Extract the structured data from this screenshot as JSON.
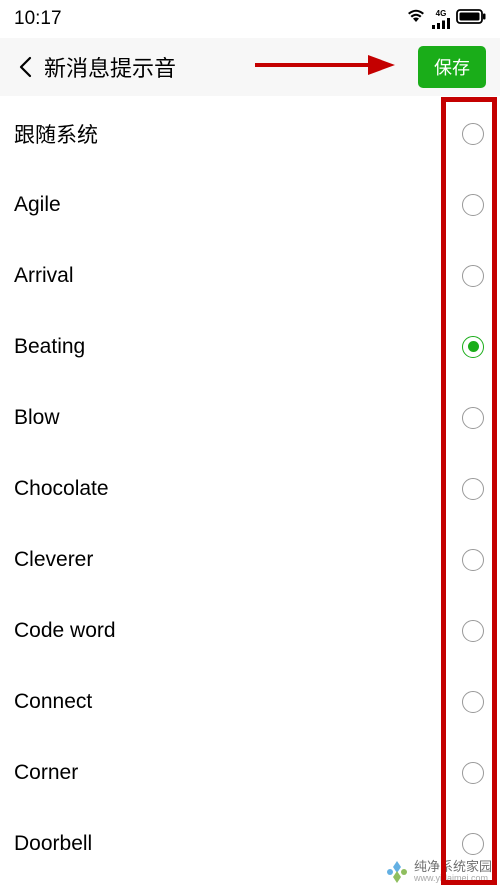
{
  "status": {
    "time": "10:17",
    "network_type": "4G"
  },
  "header": {
    "title": "新消息提示音",
    "save_label": "保存"
  },
  "colors": {
    "accent": "#1aad19",
    "annotation": "#c40000"
  },
  "list": {
    "items": [
      {
        "label": "跟随系统",
        "selected": false
      },
      {
        "label": "Agile",
        "selected": false
      },
      {
        "label": "Arrival",
        "selected": false
      },
      {
        "label": "Beating",
        "selected": true
      },
      {
        "label": "Blow",
        "selected": false
      },
      {
        "label": "Chocolate",
        "selected": false
      },
      {
        "label": "Cleverer",
        "selected": false
      },
      {
        "label": "Code word",
        "selected": false
      },
      {
        "label": "Connect",
        "selected": false
      },
      {
        "label": "Corner",
        "selected": false
      },
      {
        "label": "Doorbell",
        "selected": false
      }
    ]
  },
  "watermark": {
    "title": "纯净系统家园",
    "url": "www.yidaimei.com"
  }
}
